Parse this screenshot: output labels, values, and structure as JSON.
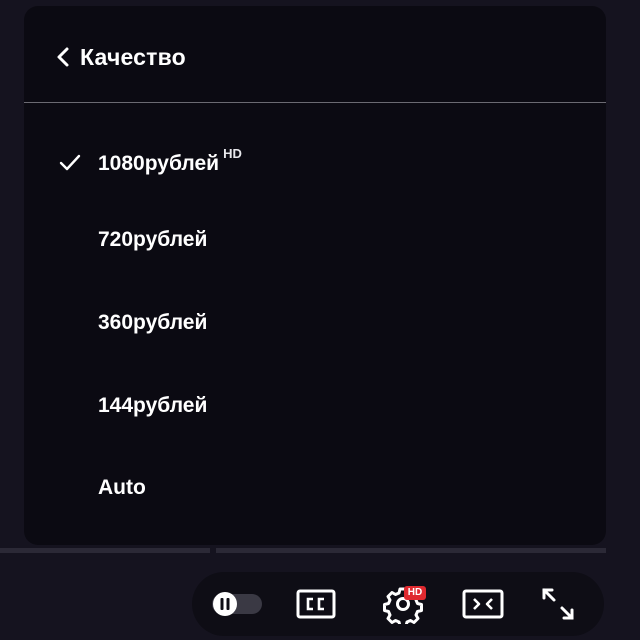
{
  "quality_menu": {
    "title": "Качество",
    "options": [
      {
        "label": "1080рублей",
        "badge": "HD",
        "selected": true
      },
      {
        "label": "720рублей",
        "badge": "",
        "selected": false
      },
      {
        "label": "360рублей",
        "badge": "",
        "selected": false
      },
      {
        "label": "144рублей",
        "badge": "",
        "selected": false
      },
      {
        "label": "Auto",
        "badge": "",
        "selected": false
      }
    ]
  },
  "controls": {
    "autoplay_icon": "pause-toggle-icon",
    "cc_icon": "closed-captions-icon",
    "settings_icon": "gear-icon",
    "settings_badge": "HD",
    "miniplayer_icon": "miniplayer-icon",
    "fullscreen_icon": "fullscreen-icon"
  },
  "colors": {
    "panel_bg": "#0b0a12",
    "page_bg": "#15131f",
    "text": "#ffffff",
    "badge_red": "#e0292f"
  }
}
